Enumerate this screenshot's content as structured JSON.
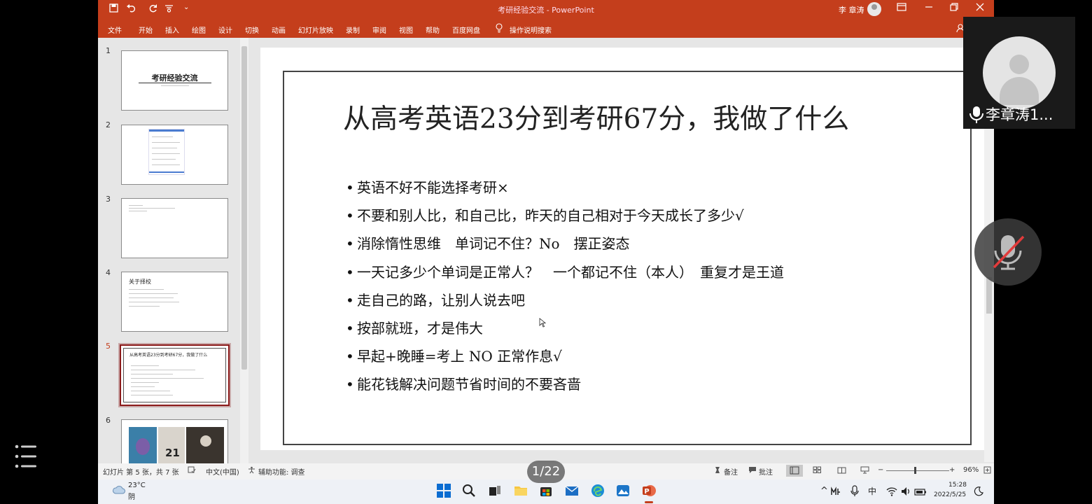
{
  "window": {
    "doc_title": "考研经验交流 - PowerPoint",
    "user_name": "李 章涛",
    "quick_access": [
      "save-icon",
      "undo-icon",
      "redo-icon",
      "touch-mode-icon"
    ]
  },
  "ribbon": {
    "tabs": [
      "文件",
      "开始",
      "插入",
      "绘图",
      "设计",
      "切换",
      "动画",
      "幻灯片放映",
      "录制",
      "审阅",
      "视图",
      "帮助",
      "百度网盘"
    ],
    "tell_me": "操作说明搜索"
  },
  "thumbnails": [
    {
      "number": "1",
      "title": "考研经验交流"
    },
    {
      "number": "2",
      "title": ""
    },
    {
      "number": "3",
      "title": ""
    },
    {
      "number": "4",
      "title": "关于择校"
    },
    {
      "number": "5",
      "title": "从高考英语23分到考研67分，我做了什么"
    },
    {
      "number": "6",
      "title": "21"
    }
  ],
  "slide": {
    "title": "从高考英语23分到考研67分，我做了什么",
    "bullets": [
      "英语不好不能选择考研×",
      "不要和别人比，和自己比，昨天的自己相对于今天成长了多少√",
      "消除惰性思维　单词记不住？No　摆正姿态",
      "一天记多少个单词是正常人？　一个都记不住（本人）　重复才是王道",
      "走自己的路，让别人说去吧",
      "按部就班，才是伟大",
      "早起+晚睡=考上 NO 正常作息√",
      "能花钱解决问题节省时间的不要吝啬"
    ]
  },
  "status": {
    "slide_info": "幻灯片 第 5 张，共 7 张",
    "language": "中文(中国)",
    "accessibility": "辅助功能: 调查",
    "notes": "备注",
    "comments": "批注",
    "zoom": "96%"
  },
  "taskbar": {
    "temperature": "23°C",
    "weather": "阴",
    "ime": "中",
    "time": "15:28",
    "date": "2022/5/25"
  },
  "overlay": {
    "participant_name": "李章涛1...",
    "page_indicator": "1/22"
  },
  "colors": {
    "accent": "#c43e1c",
    "selected_thumb": "#8b1a1a"
  }
}
